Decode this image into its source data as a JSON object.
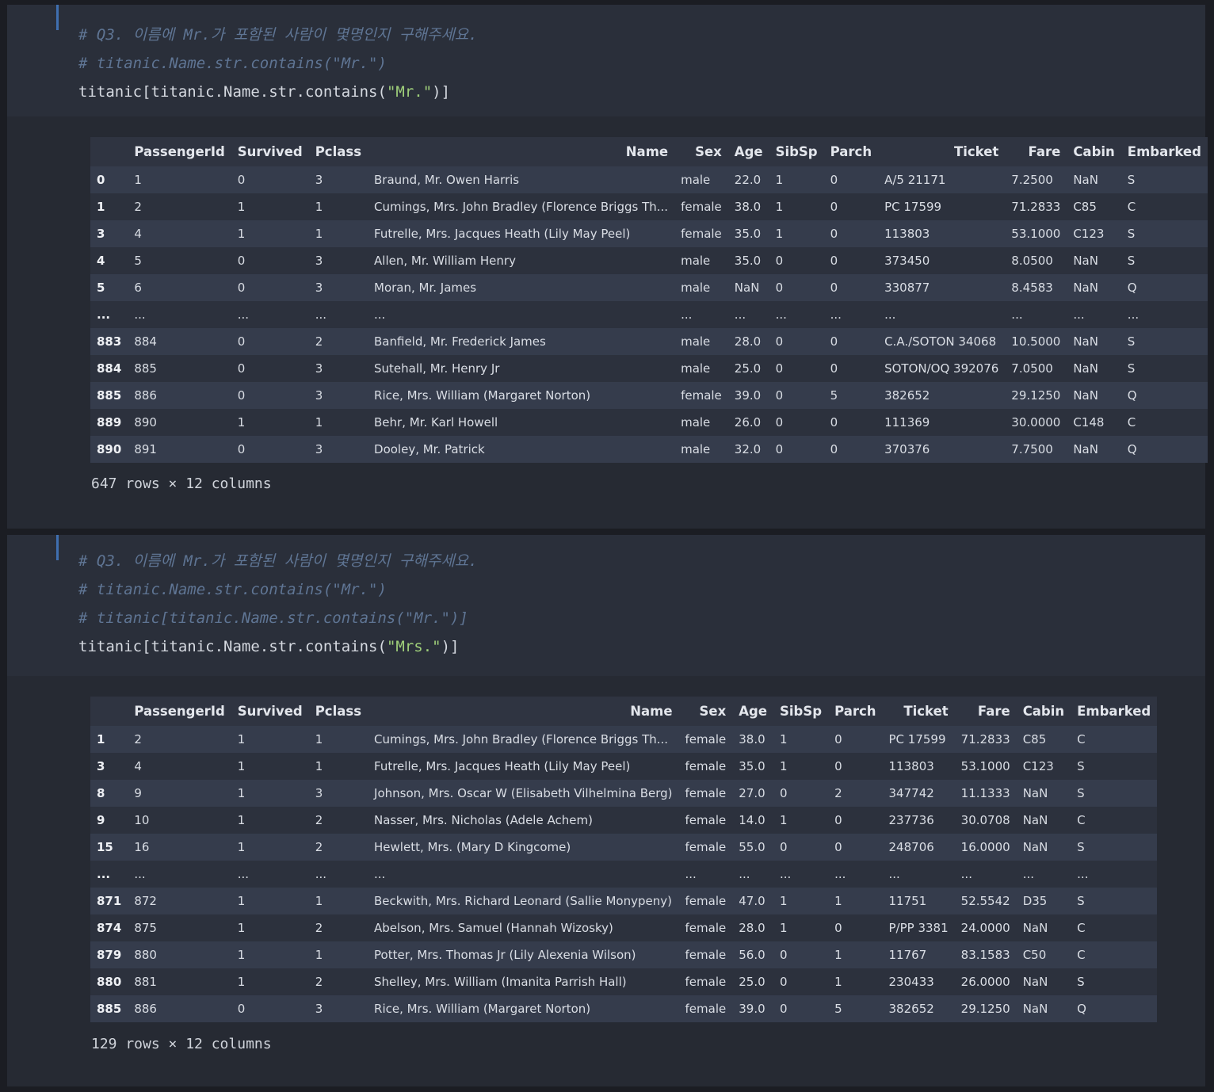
{
  "cells": [
    {
      "code": {
        "comment1": "# Q3. 이름에 Mr.가 포함된 사람이 몇명인지 구해주세요.",
        "comment2": "# titanic.Name.str.contains(\"Mr.\")",
        "code_prefix": "titanic[titanic.Name.str.contains(",
        "code_string": "\"Mr.\"",
        "code_suffix": ")]"
      },
      "table": {
        "columns": [
          "",
          "PassengerId",
          "Survived",
          "Pclass",
          "Name",
          "Sex",
          "Age",
          "SibSp",
          "Parch",
          "Ticket",
          "Fare",
          "Cabin",
          "Embarked"
        ],
        "rows": [
          [
            "0",
            "1",
            "0",
            "3",
            "Braund, Mr. Owen Harris",
            "male",
            "22.0",
            "1",
            "0",
            "A/5 21171",
            "7.2500",
            "NaN",
            "S"
          ],
          [
            "1",
            "2",
            "1",
            "1",
            "Cumings, Mrs. John Bradley (Florence Briggs Th...",
            "female",
            "38.0",
            "1",
            "0",
            "PC 17599",
            "71.2833",
            "C85",
            "C"
          ],
          [
            "3",
            "4",
            "1",
            "1",
            "Futrelle, Mrs. Jacques Heath (Lily May Peel)",
            "female",
            "35.0",
            "1",
            "0",
            "113803",
            "53.1000",
            "C123",
            "S"
          ],
          [
            "4",
            "5",
            "0",
            "3",
            "Allen, Mr. William Henry",
            "male",
            "35.0",
            "0",
            "0",
            "373450",
            "8.0500",
            "NaN",
            "S"
          ],
          [
            "5",
            "6",
            "0",
            "3",
            "Moran, Mr. James",
            "male",
            "NaN",
            "0",
            "0",
            "330877",
            "8.4583",
            "NaN",
            "Q"
          ],
          [
            "...",
            "...",
            "...",
            "...",
            "...",
            "...",
            "...",
            "...",
            "...",
            "...",
            "...",
            "...",
            "..."
          ],
          [
            "883",
            "884",
            "0",
            "2",
            "Banfield, Mr. Frederick James",
            "male",
            "28.0",
            "0",
            "0",
            "C.A./SOTON 34068",
            "10.5000",
            "NaN",
            "S"
          ],
          [
            "884",
            "885",
            "0",
            "3",
            "Sutehall, Mr. Henry Jr",
            "male",
            "25.0",
            "0",
            "0",
            "SOTON/OQ 392076",
            "7.0500",
            "NaN",
            "S"
          ],
          [
            "885",
            "886",
            "0",
            "3",
            "Rice, Mrs. William (Margaret Norton)",
            "female",
            "39.0",
            "0",
            "5",
            "382652",
            "29.1250",
            "NaN",
            "Q"
          ],
          [
            "889",
            "890",
            "1",
            "1",
            "Behr, Mr. Karl Howell",
            "male",
            "26.0",
            "0",
            "0",
            "111369",
            "30.0000",
            "C148",
            "C"
          ],
          [
            "890",
            "891",
            "0",
            "3",
            "Dooley, Mr. Patrick",
            "male",
            "32.0",
            "0",
            "0",
            "370376",
            "7.7500",
            "NaN",
            "Q"
          ]
        ]
      },
      "rows_info": "647 rows × 12 columns"
    },
    {
      "code": {
        "comment1": "# Q3. 이름에 Mr.가 포함된 사람이 몇명인지 구해주세요.",
        "comment2": "# titanic.Name.str.contains(\"Mr.\")",
        "comment3": "# titanic[titanic.Name.str.contains(\"Mr.\")]",
        "code_prefix": "titanic[titanic.Name.str.contains(",
        "code_string": "\"Mrs.\"",
        "code_suffix": ")]"
      },
      "table": {
        "columns": [
          "",
          "PassengerId",
          "Survived",
          "Pclass",
          "Name",
          "Sex",
          "Age",
          "SibSp",
          "Parch",
          "Ticket",
          "Fare",
          "Cabin",
          "Embarked"
        ],
        "rows": [
          [
            "1",
            "2",
            "1",
            "1",
            "Cumings, Mrs. John Bradley (Florence Briggs Th...",
            "female",
            "38.0",
            "1",
            "0",
            "PC 17599",
            "71.2833",
            "C85",
            "C"
          ],
          [
            "3",
            "4",
            "1",
            "1",
            "Futrelle, Mrs. Jacques Heath (Lily May Peel)",
            "female",
            "35.0",
            "1",
            "0",
            "113803",
            "53.1000",
            "C123",
            "S"
          ],
          [
            "8",
            "9",
            "1",
            "3",
            "Johnson, Mrs. Oscar W (Elisabeth Vilhelmina Berg)",
            "female",
            "27.0",
            "0",
            "2",
            "347742",
            "11.1333",
            "NaN",
            "S"
          ],
          [
            "9",
            "10",
            "1",
            "2",
            "Nasser, Mrs. Nicholas (Adele Achem)",
            "female",
            "14.0",
            "1",
            "0",
            "237736",
            "30.0708",
            "NaN",
            "C"
          ],
          [
            "15",
            "16",
            "1",
            "2",
            "Hewlett, Mrs. (Mary D Kingcome)",
            "female",
            "55.0",
            "0",
            "0",
            "248706",
            "16.0000",
            "NaN",
            "S"
          ],
          [
            "...",
            "...",
            "...",
            "...",
            "...",
            "...",
            "...",
            "...",
            "...",
            "...",
            "...",
            "...",
            "..."
          ],
          [
            "871",
            "872",
            "1",
            "1",
            "Beckwith, Mrs. Richard Leonard (Sallie Monypeny)",
            "female",
            "47.0",
            "1",
            "1",
            "11751",
            "52.5542",
            "D35",
            "S"
          ],
          [
            "874",
            "875",
            "1",
            "2",
            "Abelson, Mrs. Samuel (Hannah Wizosky)",
            "female",
            "28.0",
            "1",
            "0",
            "P/PP 3381",
            "24.0000",
            "NaN",
            "C"
          ],
          [
            "879",
            "880",
            "1",
            "1",
            "Potter, Mrs. Thomas Jr (Lily Alexenia Wilson)",
            "female",
            "56.0",
            "0",
            "1",
            "11767",
            "83.1583",
            "C50",
            "C"
          ],
          [
            "880",
            "881",
            "1",
            "2",
            "Shelley, Mrs. William (Imanita Parrish Hall)",
            "female",
            "25.0",
            "0",
            "1",
            "230433",
            "26.0000",
            "NaN",
            "S"
          ],
          [
            "885",
            "886",
            "0",
            "3",
            "Rice, Mrs. William (Margaret Norton)",
            "female",
            "39.0",
            "0",
            "5",
            "382652",
            "29.1250",
            "NaN",
            "Q"
          ]
        ]
      },
      "rows_info": "129 rows × 12 columns"
    }
  ]
}
